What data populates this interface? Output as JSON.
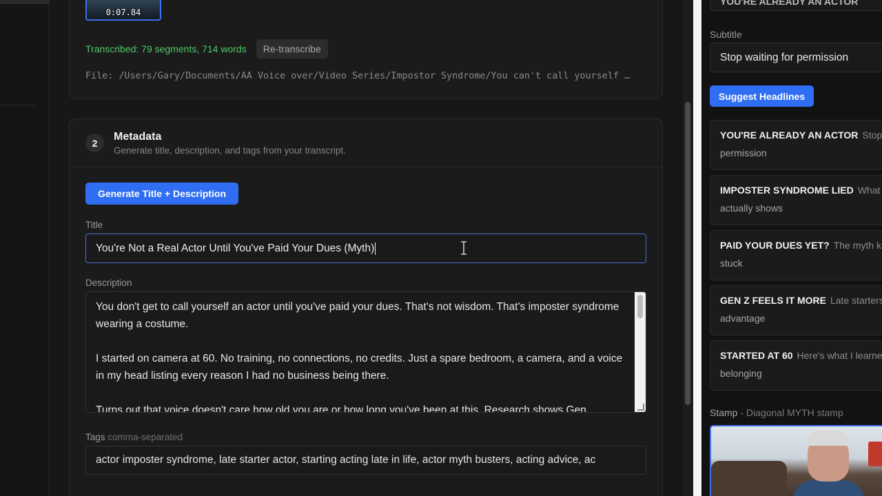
{
  "video": {
    "thumbnail_time": "0:07.84",
    "status_text": "Transcribed: 79 segments, 714 words",
    "retranscribe_label": "Re-transcribe",
    "file_path": "File: /Users/Gary/Documents/AA Voice over/Video Series/Impostor Syndrome/You can't call yourself …"
  },
  "metadata": {
    "step_number": "2",
    "title": "Metadata",
    "subtitle": "Generate title, description, and tags from your transcript.",
    "generate_label": "Generate Title + Description",
    "title_label": "Title",
    "title_value": "You're Not a Real Actor Until You've Paid Your Dues (Myth)",
    "description_label": "Description",
    "description_paragraphs": [
      "You don't get to call yourself an actor until you've paid your dues. That's not wisdom. That's imposter syndrome wearing a costume.",
      "I started on camera at 60. No training, no connections, no credits. Just a spare bedroom, a camera, and a voice in my head listing every reason I had no business being there.",
      "Turns out that voice doesn't care how old you are or how long you've been at this. Research shows Gen"
    ],
    "tags_label": "Tags",
    "tags_hint": "comma-separated",
    "tags_value": "actor imposter syndrome, late starter actor, starting acting late in life, actor myth busters, acting advice, ac"
  },
  "right_panel": {
    "top_input_value": "YOU'RE ALREADY AN ACTOR",
    "subtitle_label": "Subtitle",
    "subtitle_value": "Stop waiting for permission",
    "suggest_label": "Suggest Headlines",
    "headlines": [
      {
        "head": "YOU'RE ALREADY AN ACTOR",
        "rest": "Stop waiting for",
        "line2": "permission"
      },
      {
        "head": "IMPOSTER SYNDROME LIED",
        "rest": "What the research",
        "line2": "actually shows"
      },
      {
        "head": "PAID YOUR DUES YET?",
        "rest": "The myth keeping you",
        "line2": "stuck"
      },
      {
        "head": "GEN Z FEELS IT MORE",
        "rest": "Late starters have the",
        "line2": "advantage"
      },
      {
        "head": "STARTED AT 60",
        "rest": "Here's what I learned about",
        "line2": "belonging"
      }
    ],
    "stamp_label": "Stamp",
    "stamp_hint": "- Diagonal MYTH stamp"
  },
  "colors": {
    "accent": "#2f6ef2",
    "success": "#4fc969",
    "background": "#121212"
  }
}
